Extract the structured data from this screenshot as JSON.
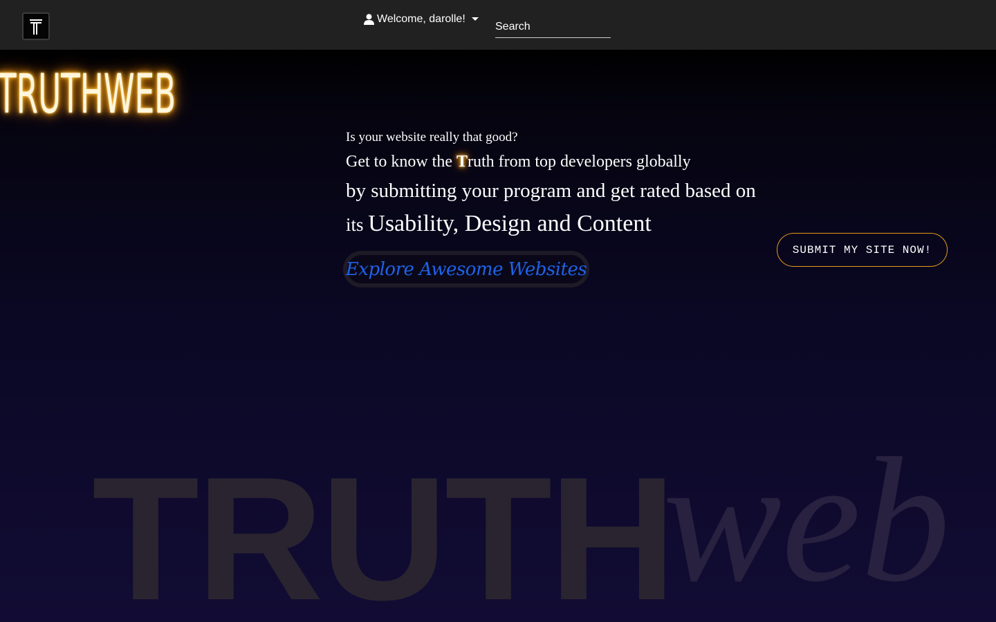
{
  "navbar": {
    "logo_letter": "T",
    "welcome_text": "Welcome, darolle!",
    "user_icon": "user-icon",
    "dropdown_icon": "caret-down-icon",
    "search": {
      "placeholder": "Search",
      "value": ""
    }
  },
  "brand": {
    "neon_logo_text": "TRUTHWEB",
    "neon_color": "#ffb020"
  },
  "hero": {
    "line1": "Is your website really that good?",
    "line2_before": "Get to know the ",
    "line2_glow": "T",
    "line2_after": "ruth from top developers globally",
    "line3": "by submitting your program and get rated based on",
    "line4_small": "its ",
    "line4_big": "Usability, Design and Content"
  },
  "buttons": {
    "explore_label": "Explore Awesome Websites",
    "explore_color": "#1f62e8",
    "submit_label": "SUBMIT MY SITE NOW!",
    "submit_border_color": "#e69a1c"
  },
  "watermark": {
    "bold_text": "TRUTH",
    "script_text": "web"
  }
}
